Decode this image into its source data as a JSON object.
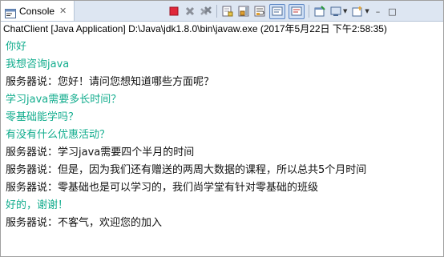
{
  "tab": {
    "label": "Console",
    "close_glyph": "✕"
  },
  "toolbar": {
    "icons": [
      "terminate-icon",
      "remove-launch-icon",
      "remove-all-terminated-icon",
      "clear-console-icon",
      "scroll-lock-icon",
      "word-wrap-icon",
      "show-on-stdout-icon",
      "show-on-stderr-icon",
      "pin-console-icon",
      "display-selected-console-icon",
      "open-console-icon",
      "minimize-icon",
      "maximize-icon"
    ],
    "terminate_color": "#e0283a",
    "minimize_glyph": "–",
    "maximize_glyph": "□"
  },
  "process_title": "ChatClient [Java Application] D:\\Java\\jdk1.8.0\\bin\\javaw.exe (2017年5月22日 下午2:58:35)",
  "colors": {
    "client": "#13ad8e",
    "server": "#111111"
  },
  "output": [
    {
      "text": "你好",
      "kind": "client"
    },
    {
      "text": "我想咨询java",
      "kind": "client"
    },
    {
      "text": "服务器说：您好！请问您想知道哪些方面呢？",
      "kind": "server"
    },
    {
      "text": "学习java需要多长时间？",
      "kind": "client"
    },
    {
      "text": "零基础能学吗？",
      "kind": "client"
    },
    {
      "text": "有没有什么优惠活动？",
      "kind": "client"
    },
    {
      "text": "服务器说：学习java需要四个半月的时间",
      "kind": "server"
    },
    {
      "text": "服务器说：但是，因为我们还有赠送的两周大数据的课程，所以总共5个月时间",
      "kind": "server"
    },
    {
      "text": "服务器说：零基础也是可以学习的，我们尚学堂有针对零基础的班级",
      "kind": "server"
    },
    {
      "text": "好的，谢谢！",
      "kind": "client"
    },
    {
      "text": "服务器说：不客气，欢迎您的加入",
      "kind": "server"
    }
  ]
}
